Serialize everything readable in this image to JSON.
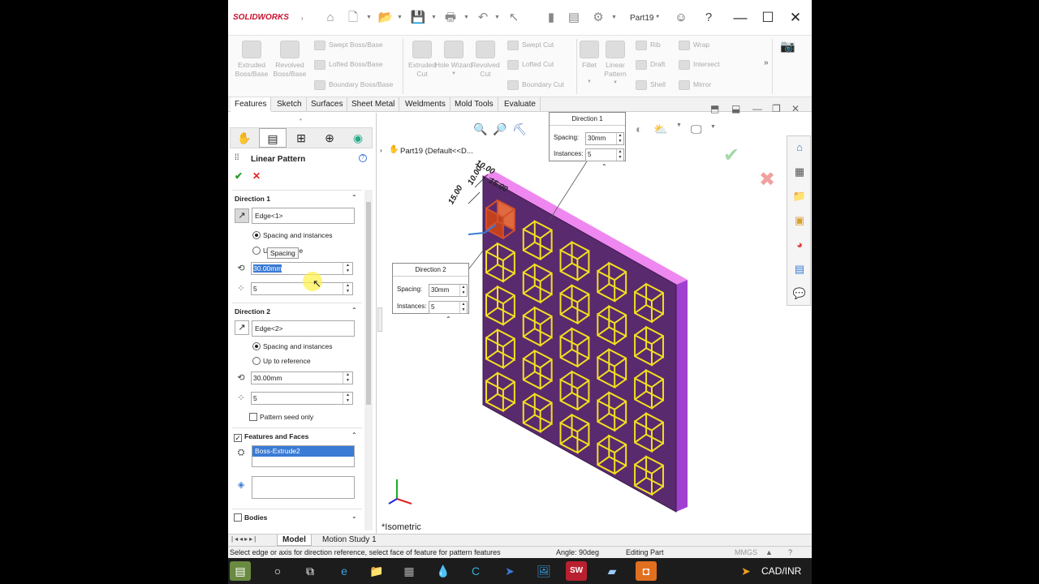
{
  "app": {
    "logo": "SOLIDWORKS",
    "doc_title": "Part19 *"
  },
  "ribbon": {
    "extruded_boss": "Extruded Boss/Base",
    "revolved_boss": "Revolved Boss/Base",
    "swept_boss": "Swept Boss/Base",
    "lofted_boss": "Lofted Boss/Base",
    "boundary_boss": "Boundary Boss/Base",
    "extruded_cut": "Extruded Cut",
    "hole_wizard": "Hole Wizard",
    "revolved_cut": "Revolved Cut",
    "swept_cut": "Swept Cut",
    "lofted_cut": "Lofted Cut",
    "boundary_cut": "Boundary Cut",
    "fillet": "Fillet",
    "linear_pattern": "Linear Pattern",
    "rib": "Rib",
    "draft": "Draft",
    "shell": "Shell",
    "wrap": "Wrap",
    "intersect": "Intersect",
    "mirror": "Mirror"
  },
  "tabs": [
    "Features",
    "Sketch",
    "Surfaces",
    "Sheet Metal",
    "Weldments",
    "Mold Tools",
    "Evaluate"
  ],
  "panel": {
    "title": "Linear Pattern",
    "dir1": {
      "heading": "Direction 1",
      "edge": "Edge<1>",
      "opt1": "Spacing and instances",
      "opt2_partial": "U",
      "opt2_tail": "ce",
      "tooltip": "Spacing",
      "spacing": "30.00mm",
      "instances": "5"
    },
    "dir2": {
      "heading": "Direction 2",
      "edge": "Edge<2>",
      "opt1": "Spacing and instances",
      "opt2": "Up to reference",
      "spacing": "30.00mm",
      "instances": "5",
      "seed_only": "Pattern seed only"
    },
    "features": {
      "heading": "Features and Faces",
      "item": "Boss-Extrude2"
    },
    "bodies": "Bodies"
  },
  "viewport": {
    "tree_label": "Part19  (Default<<D...",
    "callout1": {
      "title": "Direction 1",
      "spacing_label": "Spacing:",
      "spacing": "30mm",
      "instances_label": "Instances:",
      "instances": "5"
    },
    "callout2": {
      "title": "Direction 2",
      "spacing_label": "Spacing:",
      "spacing": "30mm",
      "instances_label": "Instances:",
      "instances": "5"
    },
    "dims": [
      "10.00",
      "10.00",
      "15.00",
      "15.00"
    ],
    "view_name": "*Isometric"
  },
  "bottom_tabs": [
    "Model",
    "Motion Study 1"
  ],
  "status": {
    "message": "Select edge or axis for direction reference, select face of feature for pattern features",
    "angle": "Angle: 90deg",
    "mode": "Editing Part",
    "units": "MMGS"
  },
  "taskbar": {
    "tray_text": "CAD/INR"
  },
  "colors": {
    "plate_face": "#5a2a6e",
    "plate_side": "#a040d0",
    "plate_top": "#ee88f0",
    "pattern": "#f2e020",
    "seed": "#d2502a"
  }
}
